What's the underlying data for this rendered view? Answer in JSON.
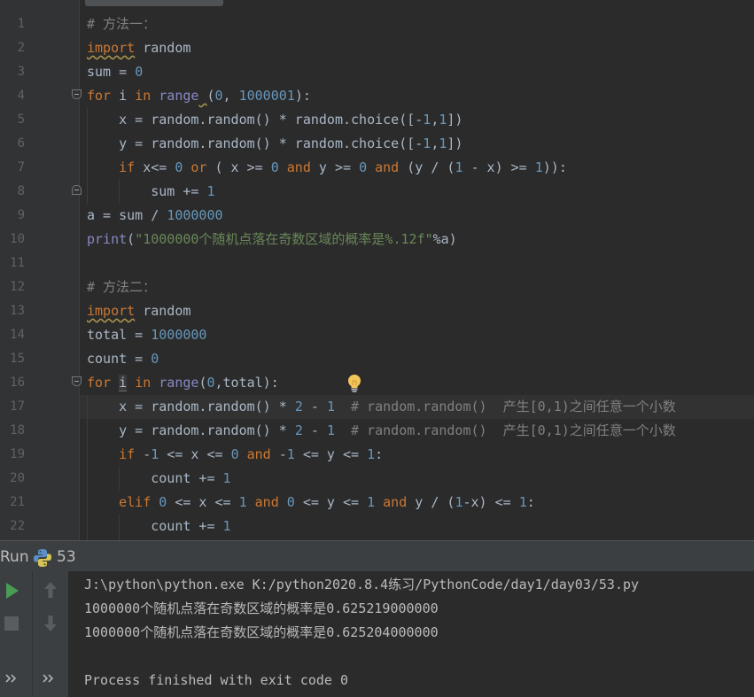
{
  "editor": {
    "lines": [
      {
        "n": "1",
        "text": "# 方法一："
      },
      {
        "n": "2",
        "text": "import random"
      },
      {
        "n": "3",
        "text": "sum = 0"
      },
      {
        "n": "4",
        "text": "for i in range (0, 1000001):"
      },
      {
        "n": "5",
        "text": "    x = random.random() * random.choice([-1,1])"
      },
      {
        "n": "6",
        "text": "    y = random.random() * random.choice([-1,1])"
      },
      {
        "n": "7",
        "text": "    if x<= 0 or ( x >= 0 and y >= 0 and (y / (1 - x) >= 1)):"
      },
      {
        "n": "8",
        "text": "        sum += 1"
      },
      {
        "n": "9",
        "text": "a = sum / 1000000"
      },
      {
        "n": "10",
        "text": "print(\"1000000个随机点落在奇数区域的概率是%.12f\"%a)"
      },
      {
        "n": "11",
        "text": ""
      },
      {
        "n": "12",
        "text": "# 方法二："
      },
      {
        "n": "13",
        "text": "import random"
      },
      {
        "n": "14",
        "text": "total = 1000000"
      },
      {
        "n": "15",
        "text": "count = 0"
      },
      {
        "n": "16",
        "text": "for i in range(0,total):"
      },
      {
        "n": "17",
        "text": "    x = random.random() * 2 - 1  # random.random()  产生[0,1)之间任意一个小数"
      },
      {
        "n": "18",
        "text": "    y = random.random() * 2 - 1  # random.random()  产生[0,1)之间任意一个小数"
      },
      {
        "n": "19",
        "text": "    if -1 <= x <= 0 and -1 <= y <= 1:"
      },
      {
        "n": "20",
        "text": "        count += 1"
      },
      {
        "n": "21",
        "text": "    elif 0 <= x <= 1 and 0 <= y <= 1 and y / (1-x) <= 1:"
      },
      {
        "n": "22",
        "text": "        count += 1"
      }
    ]
  },
  "run": {
    "label": "Run",
    "config_name": "53",
    "output": [
      "J:\\python\\python.exe K:/python2020.8.4练习/PythonCode/day1/day03/53.py",
      "1000000个随机点落在奇数区域的概率是0.625219000000",
      "1000000个随机点落在奇数区域的概率是0.625204000000",
      "",
      "Process finished with exit code 0"
    ],
    "toolbar_icons": [
      "run-icon",
      "stop-icon",
      "up-arrow-icon",
      "down-arrow-icon",
      "expand-icon"
    ]
  },
  "colors": {
    "keyword": "#cc7832",
    "number": "#6897bb",
    "comment": "#808080",
    "string": "#6a8759",
    "builtin": "#8888c6",
    "default": "#a9b7c6",
    "run_green": "#499c54"
  }
}
